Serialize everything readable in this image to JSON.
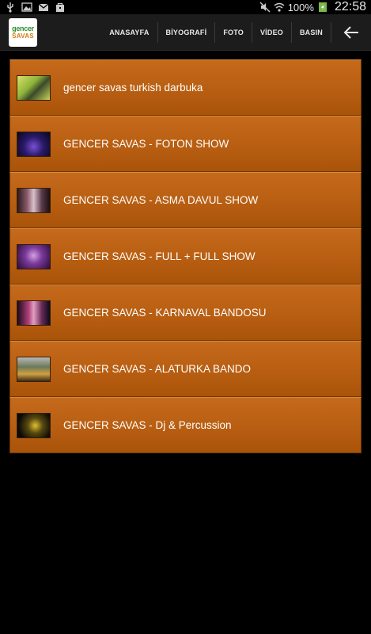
{
  "status_bar": {
    "left_icons": [
      "usb-icon",
      "image-icon",
      "gmail-icon",
      "bag-icon"
    ],
    "right_icons": [
      "mute-icon",
      "wifi-icon"
    ],
    "battery_text": "100%",
    "time": "22:58"
  },
  "app_bar": {
    "logo": {
      "top": "gencer",
      "bottom": "SAVAS"
    },
    "nav": [
      "ANASAYFA",
      "BİYOGRAFİ",
      "FOTO",
      "VİDEO",
      "BASIN"
    ],
    "back_icon": "arrow-left-icon"
  },
  "videos": [
    {
      "title": "gencer savas turkish darbuka"
    },
    {
      "title": "GENCER SAVAS - FOTON SHOW"
    },
    {
      "title": "GENCER SAVAS - ASMA DAVUL SHOW"
    },
    {
      "title": "GENCER SAVAS - FULL + FULL SHOW"
    },
    {
      "title": "GENCER SAVAS - KARNAVAL BANDOSU"
    },
    {
      "title": "GENCER SAVAS - ALATURKA BANDO"
    },
    {
      "title": "GENCER SAVAS - Dj & Percussion"
    }
  ],
  "colors": {
    "item_bg": "#b85e12",
    "app_bar_bg": "#1c1c1c",
    "background": "#000000"
  }
}
